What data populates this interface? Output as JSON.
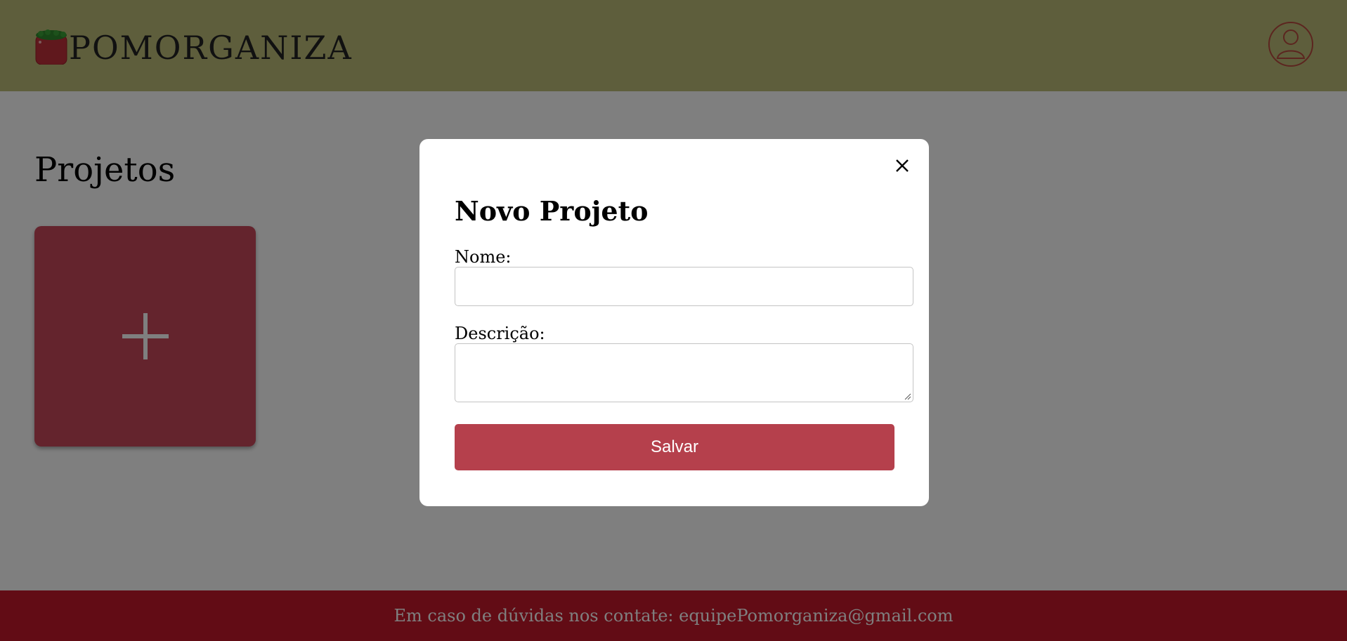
{
  "header": {
    "brand_name": "POMORGANIZA",
    "logo_icon": "tomato-logo-icon",
    "profile_icon": "user-profile-icon"
  },
  "main": {
    "page_title": "Projetos",
    "add_card_icon": "plus-icon"
  },
  "modal": {
    "title": "Novo Projeto",
    "close_icon": "close-icon",
    "name_label": "Nome:",
    "name_value": "",
    "description_label": "Descrição:",
    "description_value": "",
    "save_label": "Salvar"
  },
  "footer": {
    "contact_text": "Em caso de dúvidas nos contate: equipePomorganiza@gmail.com"
  },
  "colors": {
    "header_bg": "#bcbd79",
    "card_bg": "#c8485a",
    "footer_bg": "#c5182a",
    "save_button": "#b5404c",
    "profile_ring": "#b94b3f"
  }
}
